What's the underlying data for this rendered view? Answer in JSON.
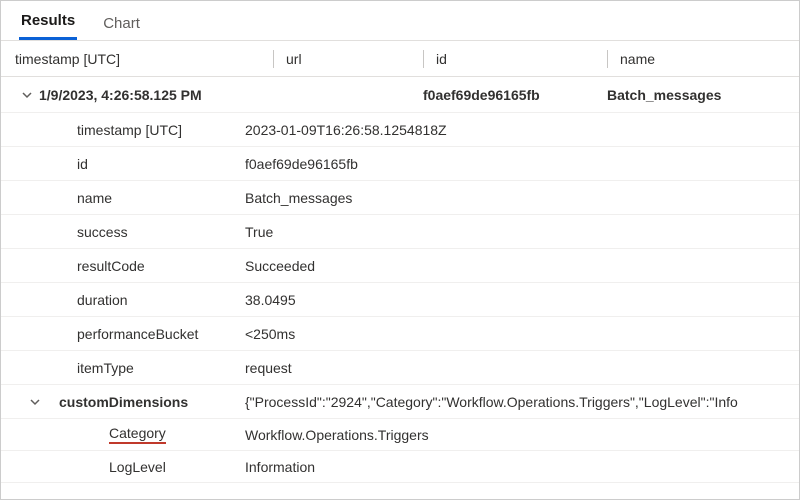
{
  "tabs": {
    "results": "Results",
    "chart": "Chart"
  },
  "columns": {
    "timestamp": "timestamp [UTC]",
    "url": "url",
    "id": "id",
    "name": "name"
  },
  "summary": {
    "timestamp": "1/9/2023, 4:26:58.125 PM",
    "url": "",
    "id": "f0aef69de96165fb",
    "name": "Batch_messages"
  },
  "details": [
    {
      "key": "timestamp [UTC]",
      "val": "2023-01-09T16:26:58.1254818Z"
    },
    {
      "key": "id",
      "val": "f0aef69de96165fb"
    },
    {
      "key": "name",
      "val": "Batch_messages"
    },
    {
      "key": "success",
      "val": "True"
    },
    {
      "key": "resultCode",
      "val": "Succeeded"
    },
    {
      "key": "duration",
      "val": "38.0495"
    },
    {
      "key": "performanceBucket",
      "val": "<250ms"
    },
    {
      "key": "itemType",
      "val": "request"
    }
  ],
  "customDimensions": {
    "label": "customDimensions",
    "raw": "{\"ProcessId\":\"2924\",\"Category\":\"Workflow.Operations.Triggers\",\"LogLevel\":\"Info",
    "items": [
      {
        "key": "Category",
        "val": "Workflow.Operations.Triggers",
        "highlight": true
      },
      {
        "key": "LogLevel",
        "val": "Information",
        "highlight": false
      }
    ]
  }
}
